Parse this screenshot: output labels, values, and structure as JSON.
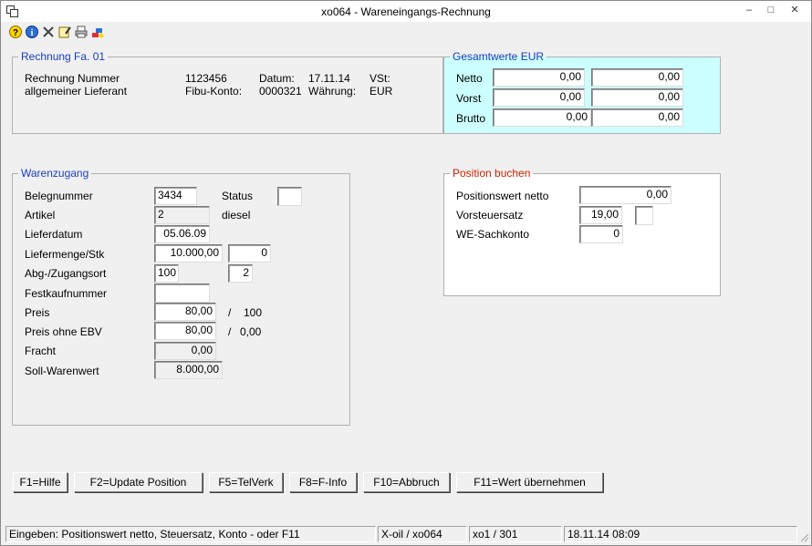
{
  "window": {
    "title": "xo064 - Wareneingangs-Rechnung",
    "minimize": "–",
    "maximize": "□",
    "close": "✕"
  },
  "toolbar": {
    "icons": [
      "help-icon",
      "info-icon",
      "delete-icon",
      "edit-icon",
      "print-icon",
      "paint-icon"
    ]
  },
  "rechnung": {
    "title": "Rechnung Fa. 01",
    "nummer_label": "Rechnung Nummer",
    "nummer_value": "1123456",
    "datum_label": "Datum:",
    "datum_value": "17.11.14",
    "vst_label": "VSt:",
    "lieferant_label": "allgemeiner Lieferant",
    "fibu_label": "Fibu-Konto:",
    "fibu_value": "0000321",
    "waehrung_label": "Währung:",
    "waehrung_value": "EUR"
  },
  "gesamtwerte": {
    "title": "Gesamtwerte EUR",
    "rows": [
      {
        "label": "Netto",
        "v1": "0,00",
        "v2": "0,00"
      },
      {
        "label": "Vorst",
        "v1": "0,00",
        "v2": "0,00"
      },
      {
        "label": "Brutto",
        "v1": "0,00",
        "v2": "0,00"
      }
    ]
  },
  "warenzugang": {
    "title": "Warenzugang",
    "belegnummer_label": "Belegnummer",
    "belegnummer_value": "3434",
    "status_label": "Status",
    "status_value": "",
    "artikel_label": "Artikel",
    "artikel_value": "2",
    "artikel_name": "diesel",
    "lieferdatum_label": "Lieferdatum",
    "lieferdatum_value": "05.06.09",
    "liefermenge_label": "Liefermenge/Stk",
    "liefermenge_value": "10.000,00",
    "stk_value": "0",
    "abgzugang_label": "Abg-/Zugangsort",
    "abg_value": "100",
    "zugang_value": "2",
    "festkauf_label": "Festkaufnummer",
    "festkauf_value": "",
    "preis_label": "Preis",
    "preis_value": "80,00",
    "preis_slash": "/",
    "preis_per": "100",
    "preis_ohne_label": "Preis ohne EBV",
    "preis_ohne_value": "80,00",
    "preis_ohne_slash": "/",
    "preis_ohne_per": "0,00",
    "fracht_label": "Fracht",
    "fracht_value": "0,00",
    "soll_label": "Soll-Warenwert",
    "soll_value": "8.000,00"
  },
  "position": {
    "title": "Position buchen",
    "positionswert_label": "Positionswert netto",
    "positionswert_value": "0,00",
    "vorsteuersatz_label": "Vorsteuersatz",
    "vorsteuersatz_value": "19,00",
    "vorsteuer_code": "",
    "sachkonto_label": "WE-Sachkonto",
    "sachkonto_value": "0"
  },
  "buttons": {
    "f1": "F1=Hilfe",
    "f2": "F2=Update Position",
    "f5": "F5=TelVerk",
    "f8": "F8=F-Info",
    "f10": "F10=Abbruch",
    "f11": "F11=Wert übernehmen"
  },
  "statusbar": {
    "message": "Eingeben: Positionswert netto, Steuersatz, Konto - oder F11",
    "program": "X-oil / xo064",
    "user": "xo1 / 301",
    "datetime": "18.11.14 08:09"
  },
  "colors": {
    "group_title": "#1a3fbf",
    "position_title": "#cc2200",
    "gesamt_bg": "#ccffff"
  }
}
